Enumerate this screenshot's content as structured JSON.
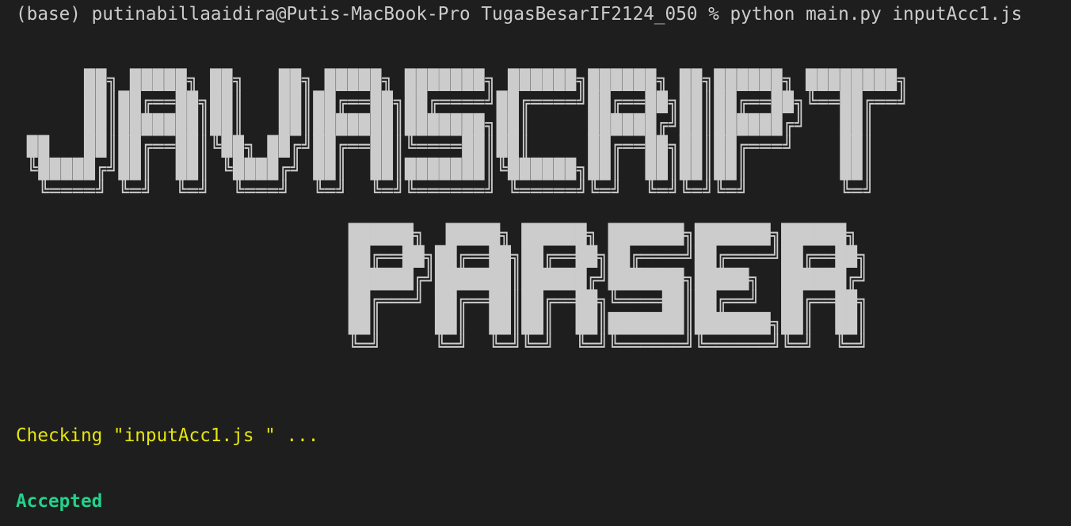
{
  "terminal": {
    "prompt": "(base) putinabillaaidira@Putis-MacBook-Pro TugasBesarIF2124_050 % python main.py inputAcc1.js",
    "banner_line1": "     ██╗ █████╗ ██╗   ██╗ █████╗ ███████╗ ██████╗██████╗ ██╗██████╗ ████████╗\n     ██║██╔══██╗██║   ██║██╔══██╗██╔════╝██╔════╝██╔══██╗██║██╔══██╗╚══██╔══╝\n     ██║███████║██║   ██║███████║███████╗██║     ██████╔╝██║██████╔╝   ██║   \n██   ██║██╔══██║╚██╗ ██╔╝██╔══██║╚════██║██║     ██╔══██╗██║██╔═══╝    ██║   \n╚█████╔╝██║  ██║ ╚████╔╝ ██║  ██║███████║╚██████╗██║  ██║██║██║        ██║   \n ╚════╝ ╚═╝  ╚═╝  ╚═══╝  ╚═╝  ╚═╝╚══════╝ ╚═════╝╚═╝  ╚═╝╚═╝╚═╝        ╚═╝   ",
    "banner_line2": "██████╗  █████╗ ██████╗ ███████╗███████╗██████╗ \n██╔══██╗██╔══██╗██╔══██╗██╔════╝██╔════╝██╔══██╗\n██████╔╝███████║██████╔╝███████╗█████╗  ██████╔╝\n██╔═══╝ ██╔══██║██╔══██╗╚════██║██╔══╝  ██╔══██╗\n██║     ██║  ██║██║  ██║███████║███████╗██║  ██║\n╚═╝     ╚═╝  ╚═╝╚═╝  ╚═╝╚══════╝╚══════╝╚═╝  ╚═╝",
    "checking": "Checking \"inputAcc1.js \" ...",
    "result": "Accepted"
  },
  "colors": {
    "background": "#1e1e1e",
    "text": "#cccccc",
    "checking": "#e5e510",
    "accepted": "#23d18b"
  }
}
